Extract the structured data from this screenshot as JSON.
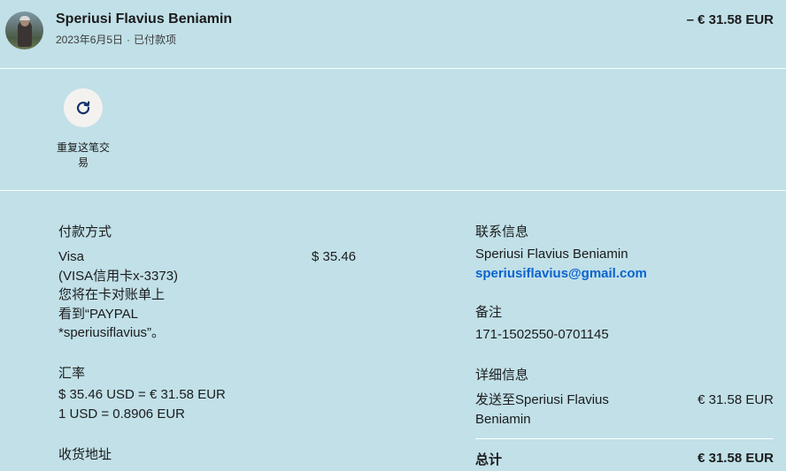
{
  "header": {
    "merchant_name": "Speriusi Flavius Beniamin",
    "date": "2023年6月5日",
    "status": "已付款项",
    "amount": "– € 31.58 EUR"
  },
  "actions": {
    "repeat_label": "重复这笔交易"
  },
  "payment": {
    "title": "付款方式",
    "card_line1": "Visa",
    "card_line2": "(VISA信用卡x-3373)",
    "statement_line1": "您将在卡对账单上",
    "statement_line2": "看到“PAYPAL",
    "statement_line3": "*speriusiflavius”。",
    "amount": "$ 35.46"
  },
  "exchange": {
    "title": "汇率",
    "line1": "$ 35.46 USD = € 31.58 EUR",
    "line2": "1 USD = 0.8906 EUR"
  },
  "shipping": {
    "title": "收货地址"
  },
  "contact": {
    "title": "联系信息",
    "name": "Speriusi Flavius Beniamin",
    "email": "speriusiflavius@gmail.com"
  },
  "note": {
    "title": "备注",
    "value": "171-1502550-0701145"
  },
  "details": {
    "title": "详细信息",
    "sent_to_line1": "发送至Speriusi Flavius",
    "sent_to_line2": "Beniamin",
    "sent_amount": "€ 31.58 EUR",
    "total_label": "总计",
    "total_amount": "€ 31.58 EUR"
  }
}
